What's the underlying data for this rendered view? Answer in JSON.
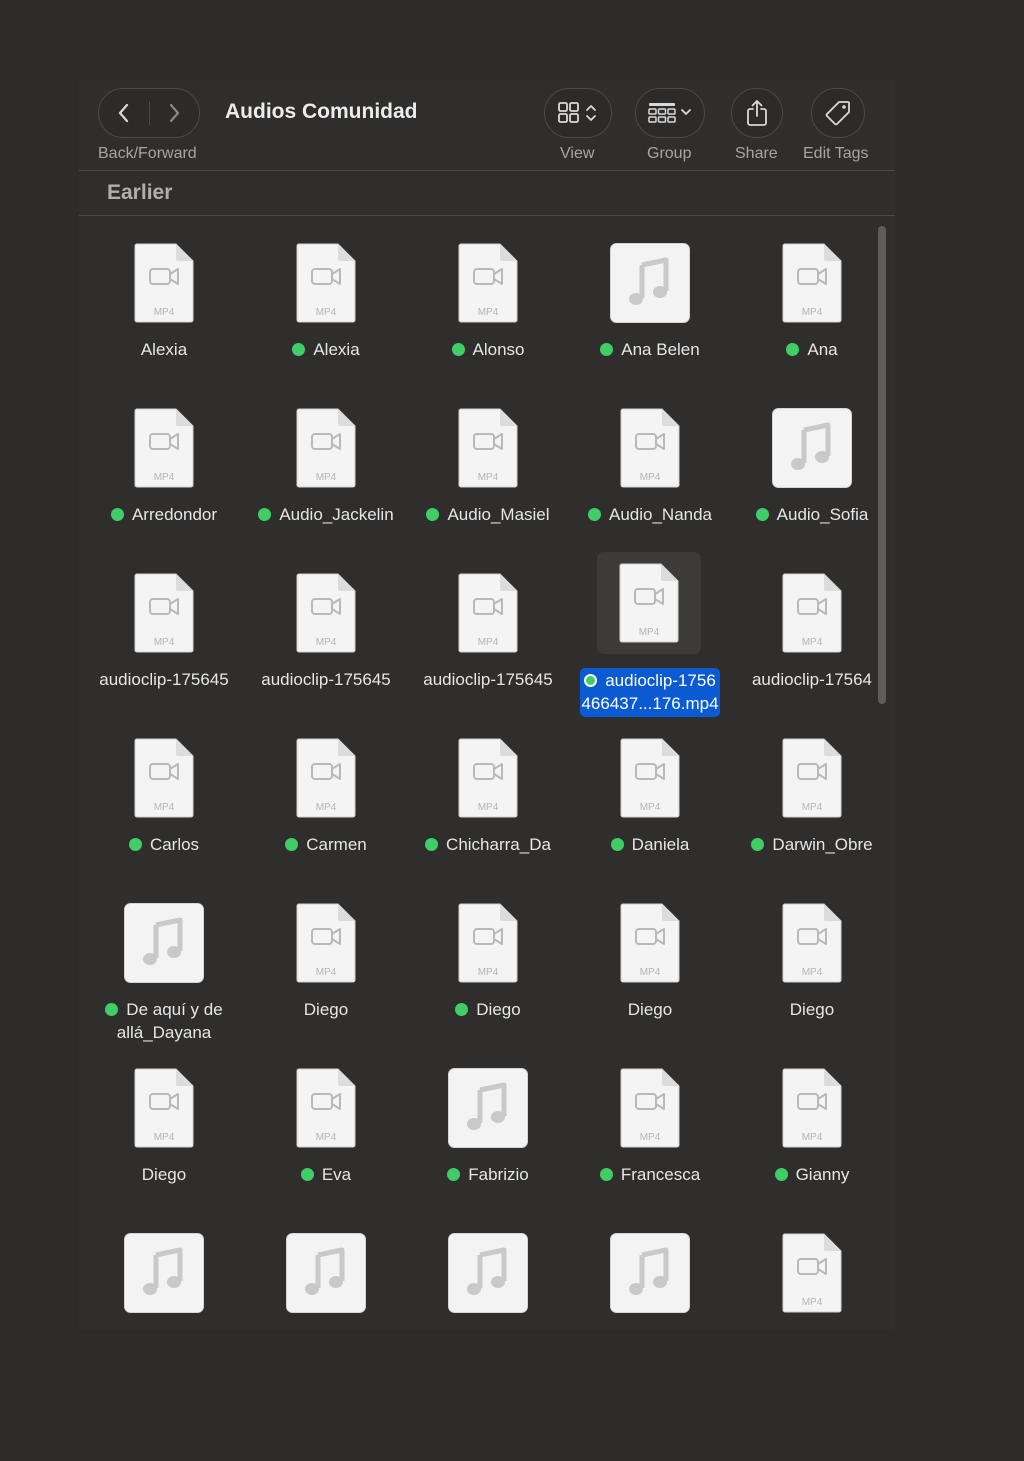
{
  "window": {
    "title": "Audios Comunidad"
  },
  "toolbar": {
    "back_forward_label": "Back/Forward",
    "view_label": "View",
    "group_label": "Group",
    "share_label": "Share",
    "edit_tags_label": "Edit Tags"
  },
  "section": {
    "title": "Earlier"
  },
  "colors": {
    "tag_green": "#3fcd66",
    "selection": "#0a5bd3",
    "background": "#2d2c2b"
  },
  "files": [
    {
      "name": "Alexia",
      "icon": "mp4-file-icon",
      "tag": false
    },
    {
      "name": "Alexia",
      "icon": "mp4-file-icon",
      "tag": true
    },
    {
      "name": "Alonso",
      "icon": "mp4-file-icon",
      "tag": true
    },
    {
      "name": "Ana Belen",
      "icon": "audio-file-icon",
      "tag": true
    },
    {
      "name": "Ana",
      "icon": "mp4-file-icon",
      "tag": true
    },
    {
      "name": "Arredondor",
      "icon": "mp4-file-icon",
      "tag": true
    },
    {
      "name": "Audio_Jackelin",
      "icon": "mp4-file-icon",
      "tag": true
    },
    {
      "name": "Audio_Masiel",
      "icon": "mp4-file-icon",
      "tag": true
    },
    {
      "name": "Audio_Nanda",
      "icon": "mp4-file-icon",
      "tag": true
    },
    {
      "name": "Audio_Sofia",
      "icon": "audio-file-icon",
      "tag": true
    },
    {
      "name": "audioclip-175645",
      "icon": "mp4-file-icon",
      "tag": false
    },
    {
      "name": "audioclip-175645",
      "icon": "mp4-file-icon",
      "tag": false
    },
    {
      "name": "audioclip-175645",
      "icon": "mp4-file-icon",
      "tag": false
    },
    {
      "name": "audioclip-1756",
      "name_line2": "466437...176.mp4",
      "icon": "mp4-file-icon",
      "tag": true,
      "selected": true
    },
    {
      "name": "audioclip-17564",
      "icon": "mp4-file-icon",
      "tag": false
    },
    {
      "name": "Carlos",
      "icon": "mp4-file-icon",
      "tag": true
    },
    {
      "name": "Carmen",
      "icon": "mp4-file-icon",
      "tag": true
    },
    {
      "name": "Chicharra_Da",
      "icon": "mp4-file-icon",
      "tag": true
    },
    {
      "name": "Daniela",
      "icon": "mp4-file-icon",
      "tag": true
    },
    {
      "name": "Darwin_Obre",
      "icon": "mp4-file-icon",
      "tag": true
    },
    {
      "name": "De aquí y de",
      "name_line2": "allá_Dayana",
      "icon": "audio-file-icon",
      "tag": true
    },
    {
      "name": "Diego",
      "icon": "mp4-file-icon",
      "tag": false
    },
    {
      "name": "Diego",
      "icon": "mp4-file-icon",
      "tag": true
    },
    {
      "name": "Diego",
      "icon": "mp4-file-icon",
      "tag": false
    },
    {
      "name": "Diego",
      "icon": "mp4-file-icon",
      "tag": false
    },
    {
      "name": "Diego",
      "icon": "mp4-file-icon",
      "tag": false
    },
    {
      "name": "Eva",
      "icon": "mp4-file-icon",
      "tag": true
    },
    {
      "name": "Fabrizio",
      "icon": "audio-file-icon",
      "tag": true
    },
    {
      "name": "Francesca",
      "icon": "mp4-file-icon",
      "tag": true
    },
    {
      "name": "Gianny",
      "icon": "mp4-file-icon",
      "tag": true
    },
    {
      "name": "",
      "icon": "audio-file-icon",
      "tag": false
    },
    {
      "name": "",
      "icon": "audio-file-icon",
      "tag": false
    },
    {
      "name": "",
      "icon": "audio-file-icon",
      "tag": false
    },
    {
      "name": "",
      "icon": "audio-file-icon",
      "tag": false
    },
    {
      "name": "",
      "icon": "mp4-file-icon",
      "tag": false
    }
  ],
  "mp4_badge": "MP4"
}
